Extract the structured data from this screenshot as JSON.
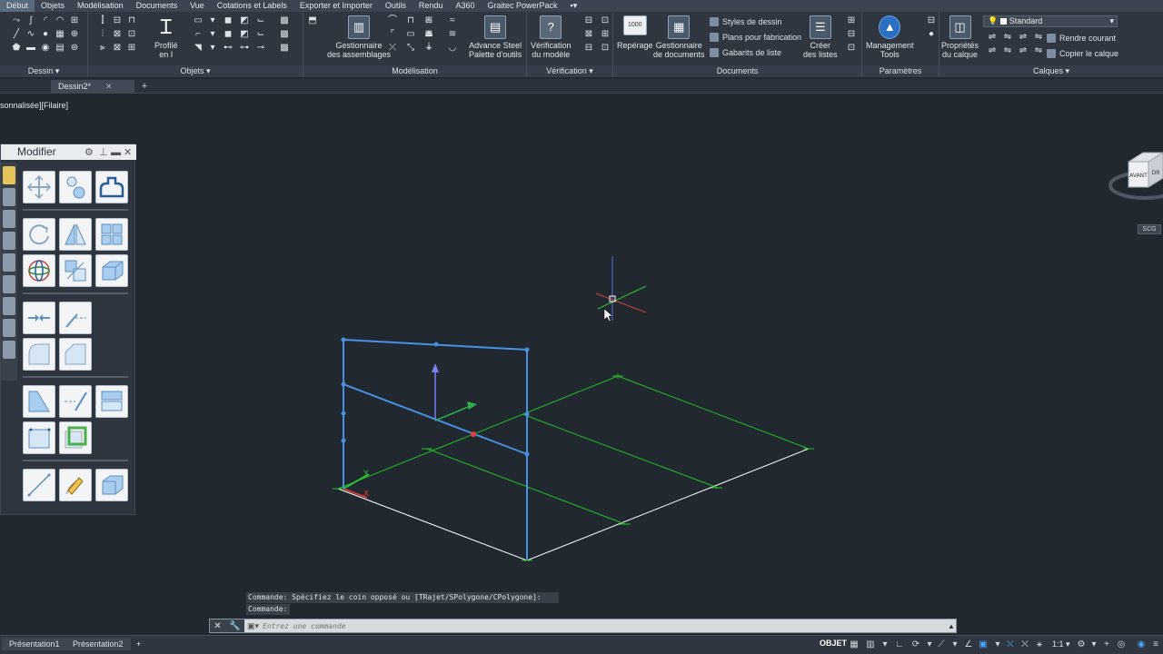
{
  "menubar": {
    "items": [
      "Début",
      "Objets",
      "Modélisation",
      "Documents",
      "Vue",
      "Cotations et Labels",
      "Exporter et Importer",
      "Outils",
      "Rendu",
      "A360",
      "Graitec PowerPack"
    ]
  },
  "ribbon": {
    "panels": {
      "dessin": "Dessin",
      "objets": "Objets",
      "modelisation": "Modélisation",
      "verification": "Vérification",
      "documents": "Documents",
      "parametres": "Paramètres",
      "calques": "Calques"
    },
    "buttons": {
      "profile": "Profilé\nen I",
      "gestionnaire_assemblages": "Gestionnaire\ndes assemblages",
      "advance_steel": "Advance Steel\nPalette d'outils",
      "verification_modele": "Vérification\ndu modèle",
      "reperage": "Repérage",
      "gestionnaire_documents": "Gestionnaire\nde documents",
      "creer_listes": "Créer\ndes listes",
      "management_tools": "Management\nTools",
      "proprietes_calque": "Propriétés\ndu calque"
    },
    "documents_small": [
      "Styles de dessin",
      "Plans pour fabrication",
      "Gabarits de liste"
    ],
    "layer_value": "Standard",
    "calques_small": [
      "Rendre courant",
      "Copier le calque"
    ],
    "reperage_badge": "1000"
  },
  "tabs": {
    "doc_tab": "Dessin2*",
    "new_tab": "+"
  },
  "viewport_label": "sonnalisée][Filaire]",
  "palette": {
    "title": "Modifier"
  },
  "viewcube": {
    "face_front": "AVANT",
    "face_right": "DR",
    "wcs": "SCG"
  },
  "command": {
    "history": [
      "Commande: Spécifiez le coin opposé ou [TRajet/SPolygone/CPolygone]:",
      "Commande:"
    ],
    "placeholder": "Entrez une commande"
  },
  "statusbar": {
    "layouts": [
      "Présentation1",
      "Présentation2"
    ],
    "add_layout": "+",
    "mode": "OBJET",
    "scale": "1:1"
  },
  "colors": {
    "beam": "#4a90e2",
    "grid": "#22c022",
    "outline": "#ffffff",
    "background": "#212830"
  }
}
